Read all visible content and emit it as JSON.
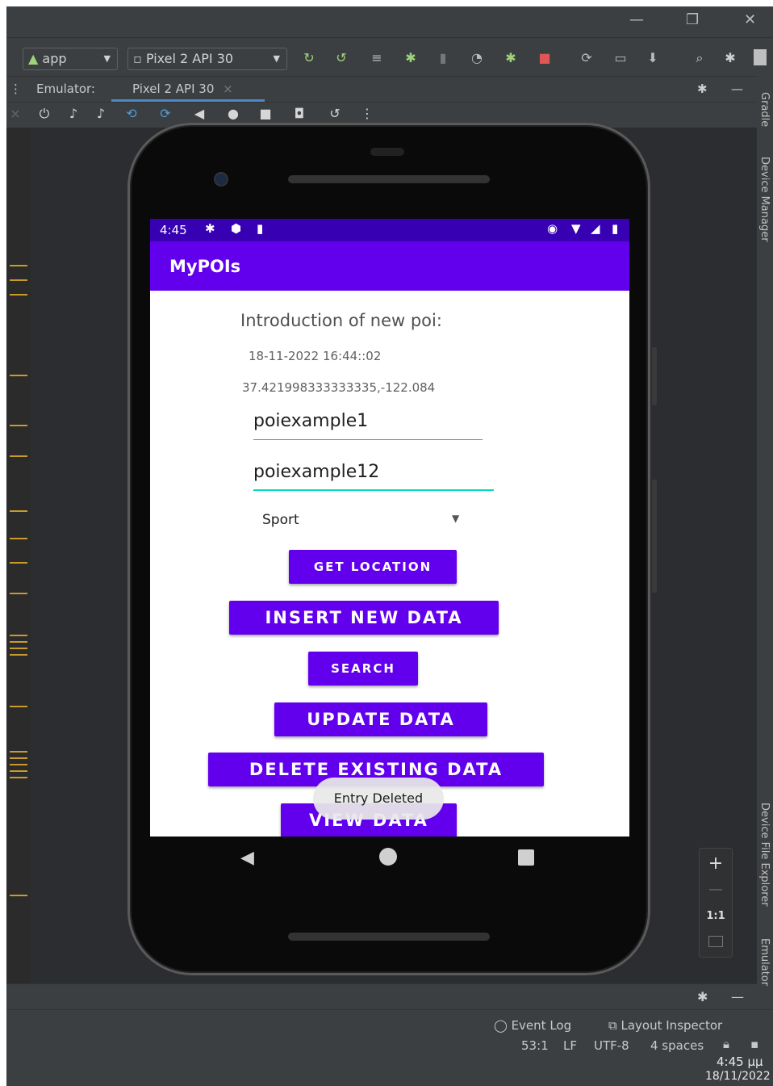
{
  "window": {
    "minimize": "—",
    "restore": "❐",
    "close": "✕"
  },
  "toolbar": {
    "run_config": "app",
    "device": "Pixel 2 API 30"
  },
  "tabs": {
    "emulator_label": "Emulator:",
    "device_tab": "Pixel 2 API 30",
    "close": "×"
  },
  "right_panels": [
    "Gradle",
    "Device Manager",
    "Device File Explorer",
    "Emulator"
  ],
  "zoom": {
    "plus": "+",
    "minus": "—",
    "ratio": "1:1"
  },
  "phone": {
    "status_time": "4:45",
    "app_title": "MyPOIs",
    "heading": "Introduction of new poi:",
    "datetime": "18-11-2022 16:44::02",
    "coords": "37.421998333333335,-122.084",
    "field1": "poiexample1",
    "field2": "poiexample12",
    "category": "Sport",
    "buttons": {
      "get_location": "GET LOCATION",
      "insert": "INSERT NEW DATA",
      "search": "SEARCH",
      "update": "UPDATE DATA",
      "delete": "DELETE EXISTING DATA",
      "view": "VIEW DATA"
    },
    "toast": "Entry Deleted"
  },
  "statusbar": {
    "event_log": "Event Log",
    "layout_inspector": "Layout Inspector",
    "position": "53:1",
    "line_sep": "LF",
    "encoding": "UTF-8",
    "indent": "4 spaces"
  },
  "taskbar": {
    "time": "4:45 μμ",
    "date": "18/11/2022"
  },
  "colors": {
    "primary": "#6200ee",
    "primary_dark": "#3700b3",
    "accent": "#03dac5"
  }
}
